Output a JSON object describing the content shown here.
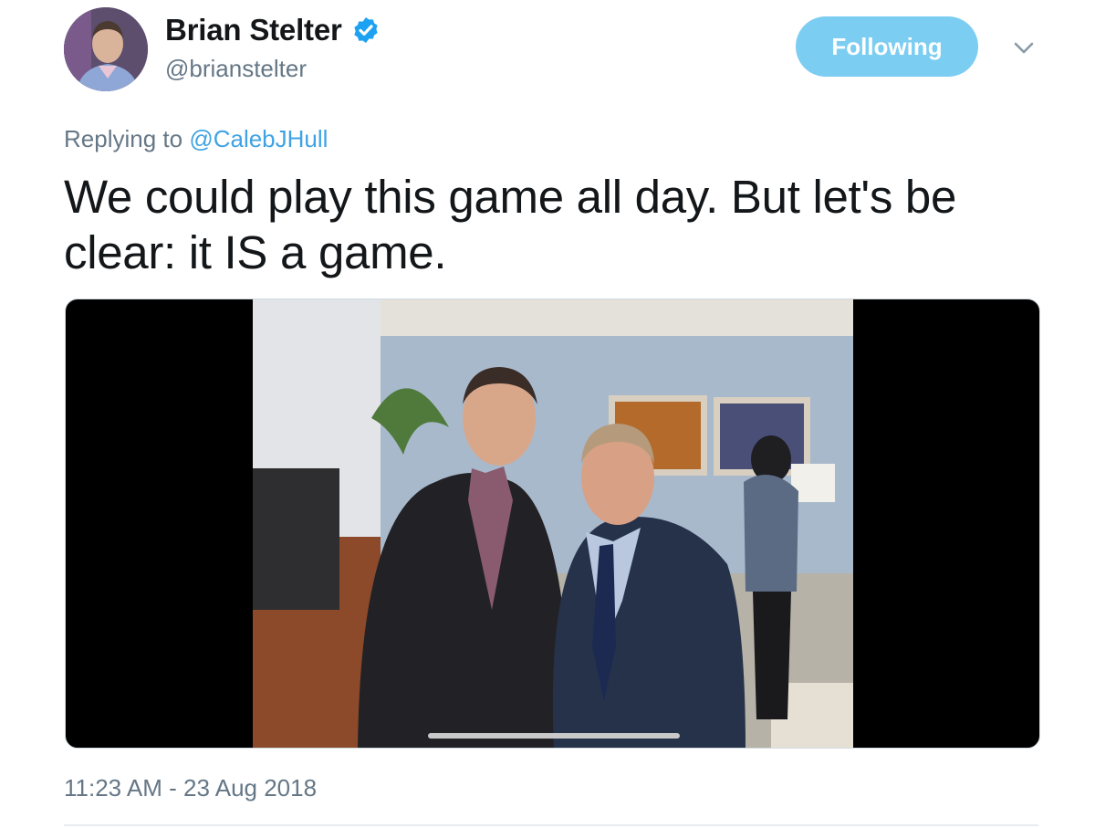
{
  "author": {
    "name": "Brian Stelter",
    "handle": "@brianstelter",
    "verified_icon": "verified-badge-icon"
  },
  "actions": {
    "follow_label": "Following",
    "menu_icon": "chevron-down-icon"
  },
  "reply": {
    "prefix": "Replying to ",
    "mention": "@CalebJHull"
  },
  "tweet": {
    "text": "We could play this game all day. But let's be clear: it IS a game."
  },
  "media": {
    "type": "photo"
  },
  "meta": {
    "timestamp": "11:23 AM - 23 Aug 2018"
  },
  "colors": {
    "follow_button": "#7ccdf2",
    "link": "#3fa3e3",
    "secondary_text": "#657786",
    "verified": "#1da1f2"
  }
}
